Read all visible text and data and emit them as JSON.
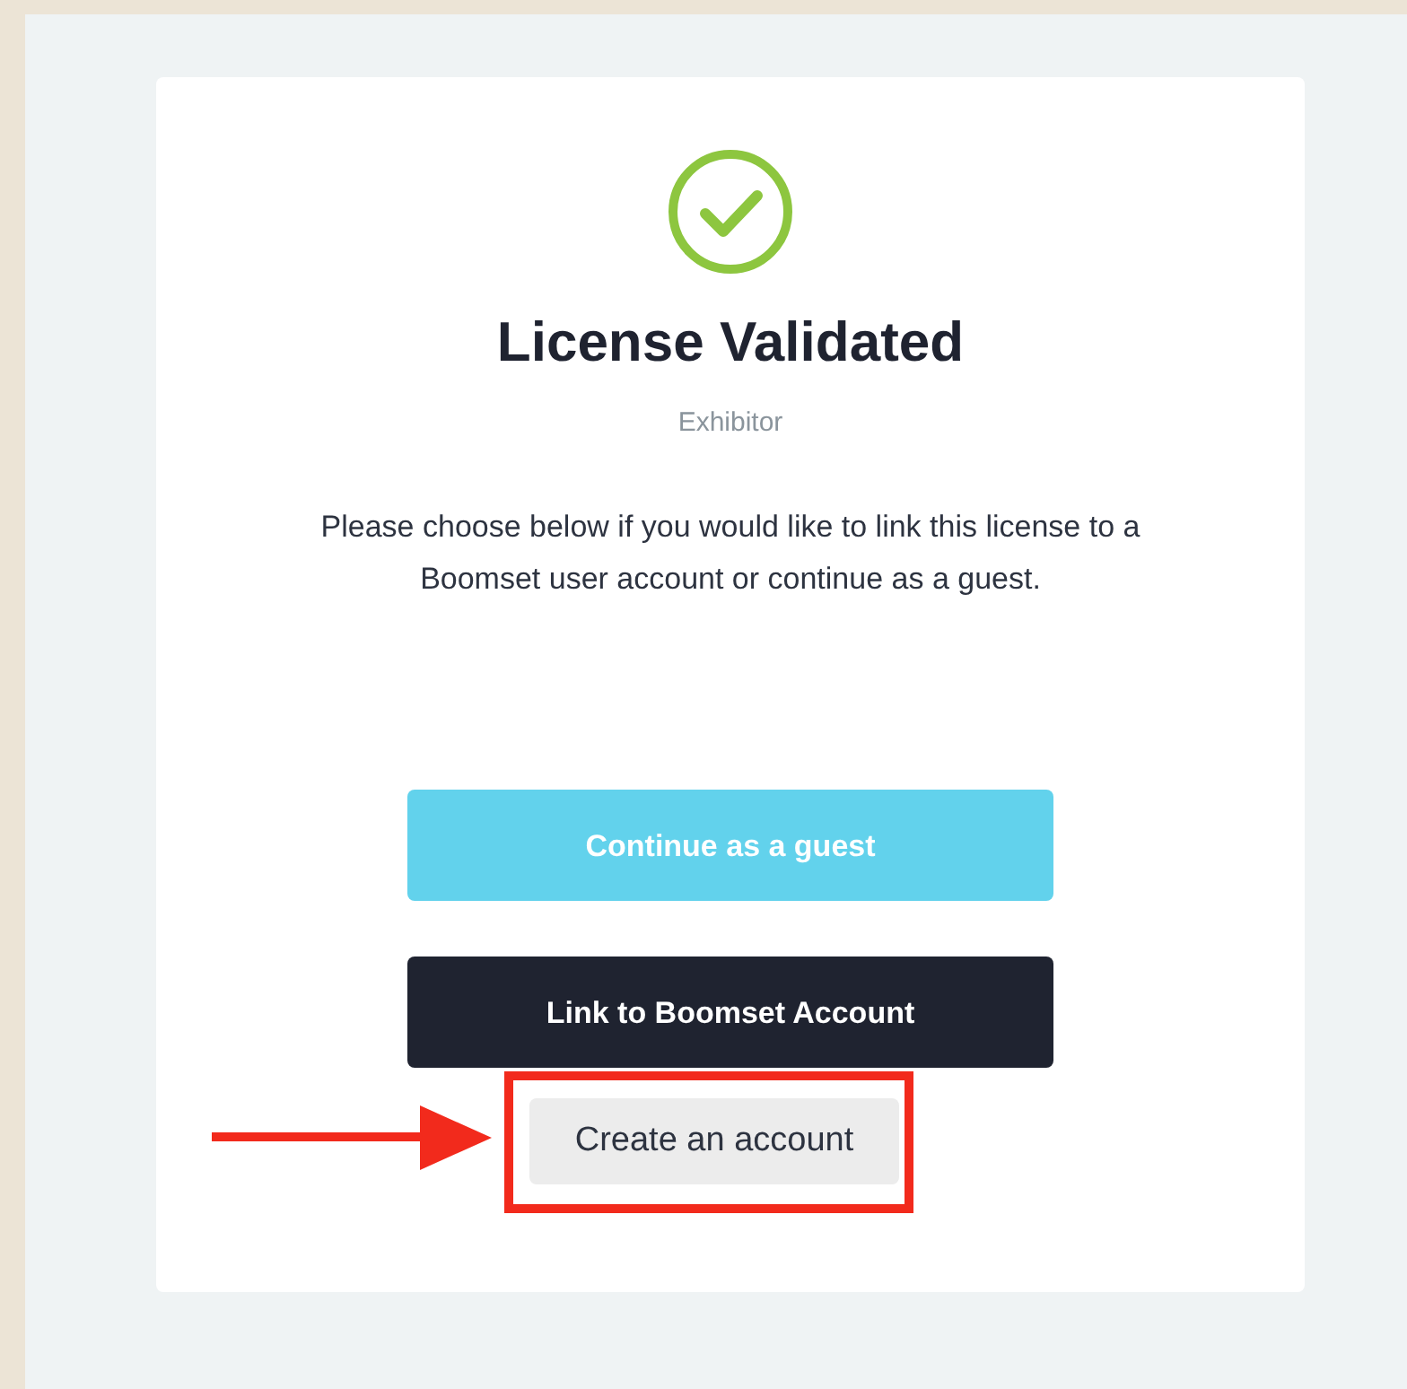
{
  "card": {
    "title": "License Validated",
    "subtitle": "Exhibitor",
    "message": "Please choose below if you would like to link this license to a Boomset user account or continue as a guest."
  },
  "buttons": [
    {
      "label": "Continue as a guest",
      "kind": "primary"
    },
    {
      "label": "Link to Boomset Account",
      "kind": "dark"
    },
    {
      "label": "Create an account",
      "kind": "secondary"
    }
  ]
}
